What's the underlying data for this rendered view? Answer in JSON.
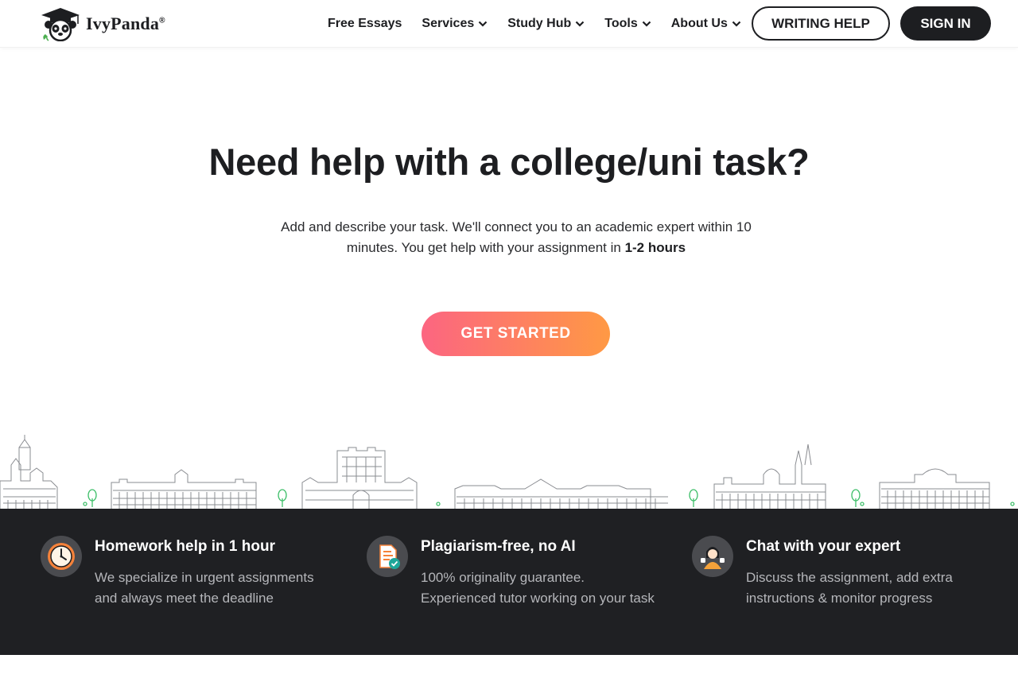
{
  "brand": {
    "name": "IvyPanda",
    "registered": "®"
  },
  "nav": {
    "items": [
      {
        "label": "Free Essays",
        "has_dropdown": false
      },
      {
        "label": "Services",
        "has_dropdown": true
      },
      {
        "label": "Study Hub",
        "has_dropdown": true
      },
      {
        "label": "Tools",
        "has_dropdown": true
      },
      {
        "label": "About Us",
        "has_dropdown": true
      }
    ],
    "writing_help": "WRITING HELP",
    "sign_in": "SIGN IN"
  },
  "hero": {
    "title": "Need help with a college/uni task?",
    "subtitle_main": "Add and describe your task. We'll connect you to an academic expert within 10 minutes. You get help with your assignment in ",
    "subtitle_bold": "1-2 hours",
    "cta": "GET STARTED"
  },
  "features": [
    {
      "icon": "clock-icon",
      "title": "Homework help in 1 hour",
      "text": "We specialize in urgent assignments and always meet the deadline"
    },
    {
      "icon": "document-check-icon",
      "title": "Plagiarism-free, no AI",
      "text": "100% originality guarantee. Experienced tutor working on your task"
    },
    {
      "icon": "expert-chat-icon",
      "title": "Chat with your expert",
      "text": "Discuss the assignment, add extra instructions & monitor progress"
    }
  ],
  "colors": {
    "dark": "#1d1e21",
    "band": "#1f2023",
    "cta_start": "#fc6581",
    "cta_end": "#ff9944",
    "icon_orange": "#f5823a",
    "icon_teal": "#1fa79a"
  }
}
